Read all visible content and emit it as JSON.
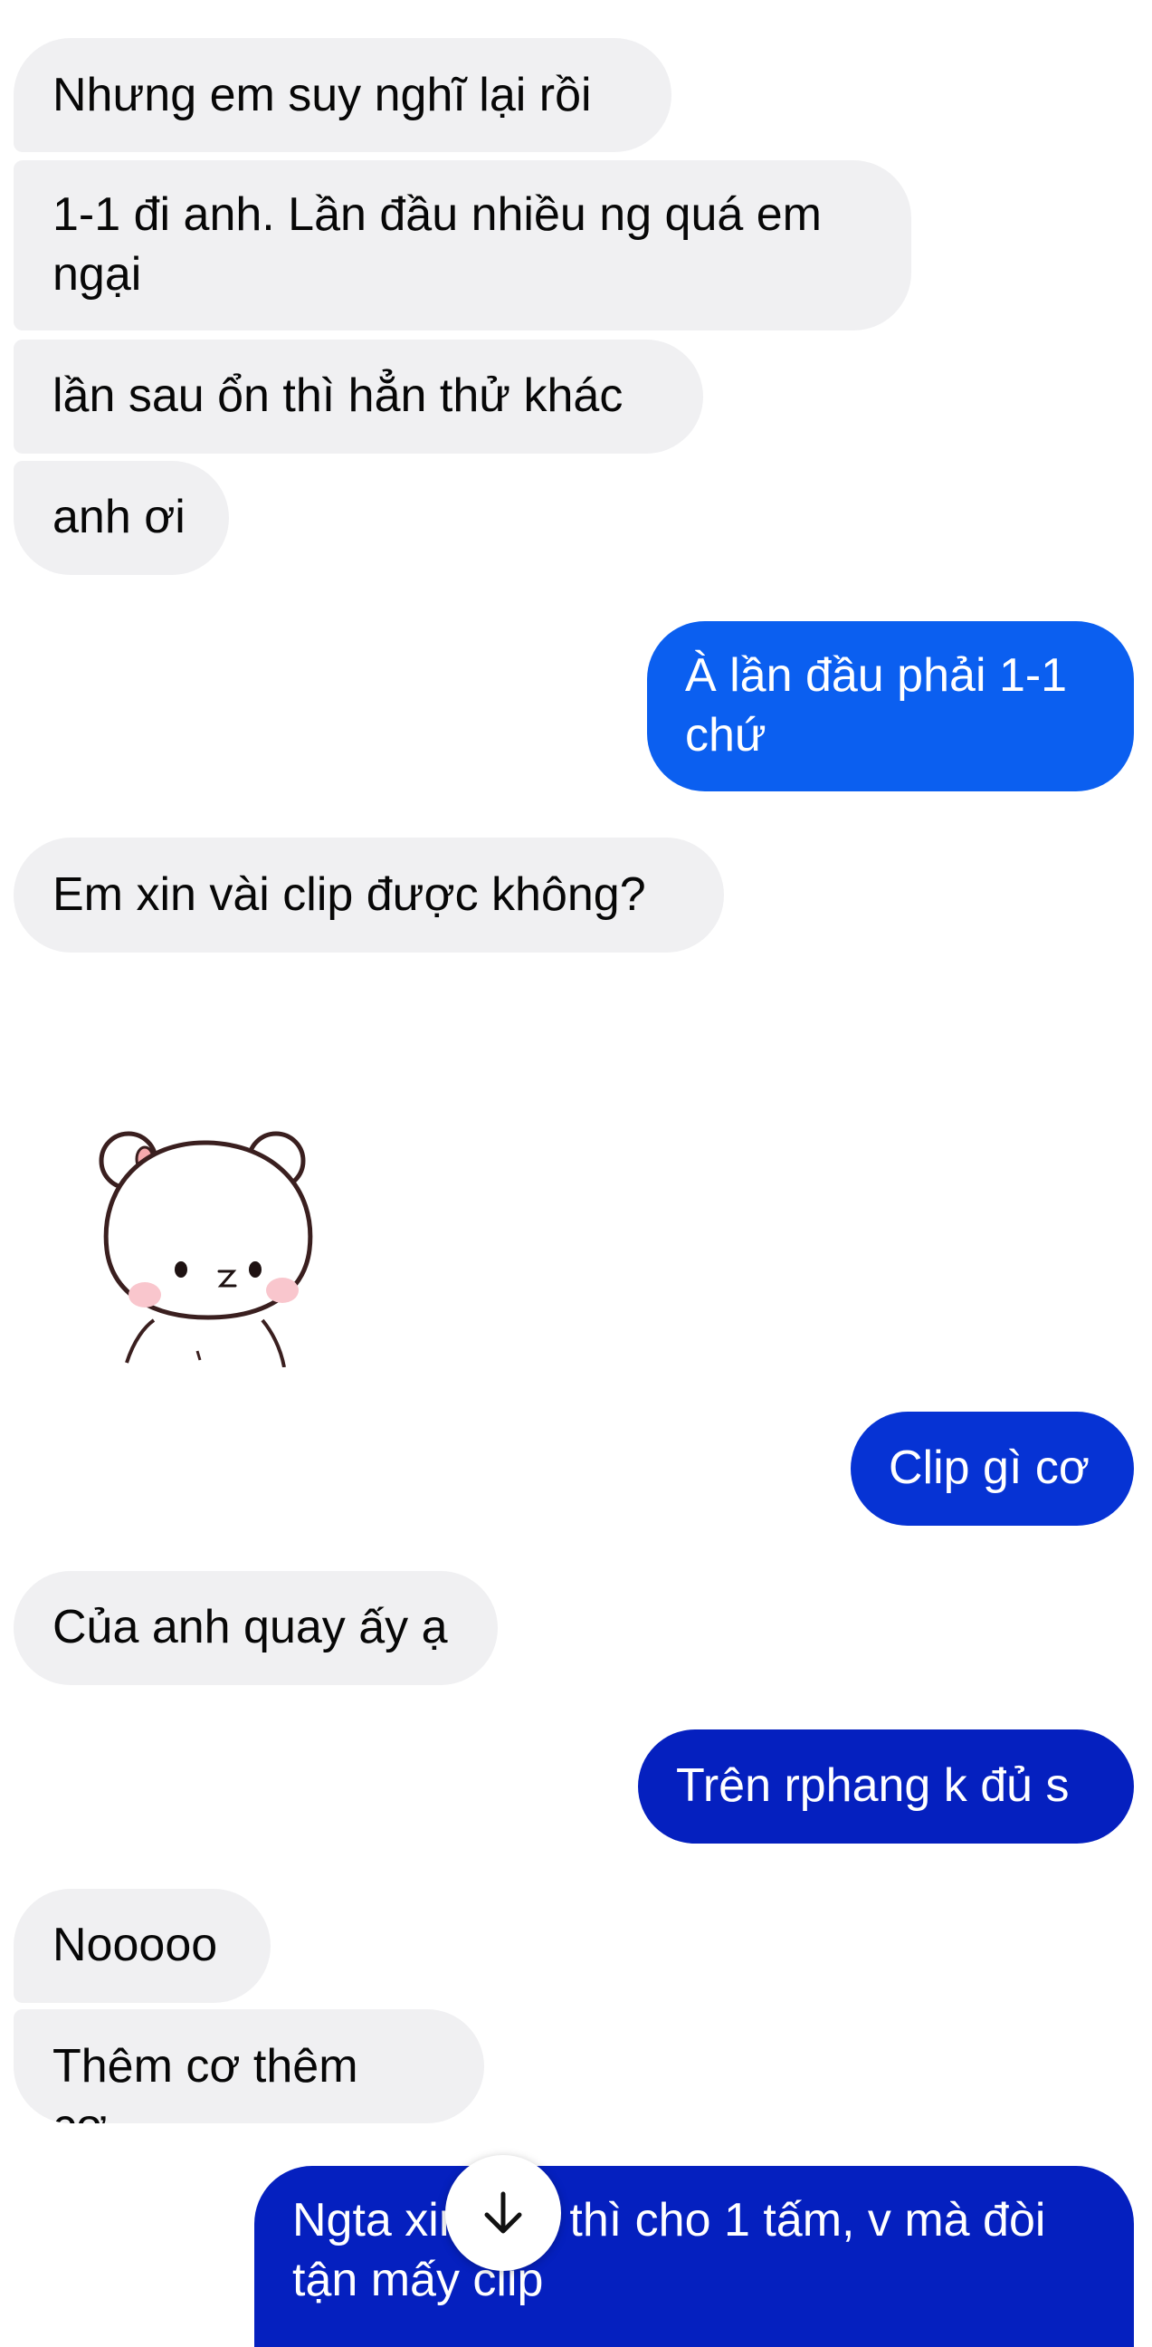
{
  "messages": [
    {
      "id": "m1",
      "text": "Nhưng em suy nghĩ lại rồi"
    },
    {
      "id": "m2",
      "text": "1-1 đi anh. Lần đầu nhiều ng quá em ngại"
    },
    {
      "id": "m3",
      "text": "lần sau ổn thì hẳn thử khác"
    },
    {
      "id": "m4",
      "text": "anh ơi"
    },
    {
      "id": "m5",
      "text": "À lần đầu phải 1-1 chứ"
    },
    {
      "id": "m6",
      "text": "Em xin vài clip được không?"
    },
    {
      "id": "m7",
      "text": "Clip gì cơ"
    },
    {
      "id": "m8",
      "text": "Của anh quay ấy ạ"
    },
    {
      "id": "m9",
      "text": "Trên rphang k đủ s"
    },
    {
      "id": "m10",
      "text": "Nooooo"
    },
    {
      "id": "m11",
      "text": "Thêm cơ thêm cơ"
    },
    {
      "id": "m12",
      "text": "Ngta xin ảnh thì cho 1 tấm, v mà đòi tận mấy clip"
    }
  ],
  "sticker": {
    "icon": "bear-sticker-icon"
  },
  "scroll_button": {
    "icon": "arrow-down-icon"
  },
  "colors": {
    "incoming_bubble": "#f0f0f2",
    "outgoing_bubble_1": "#0b5ff0",
    "outgoing_bubble_2": "#0633d4",
    "outgoing_bubble_3": "#0520bf"
  }
}
